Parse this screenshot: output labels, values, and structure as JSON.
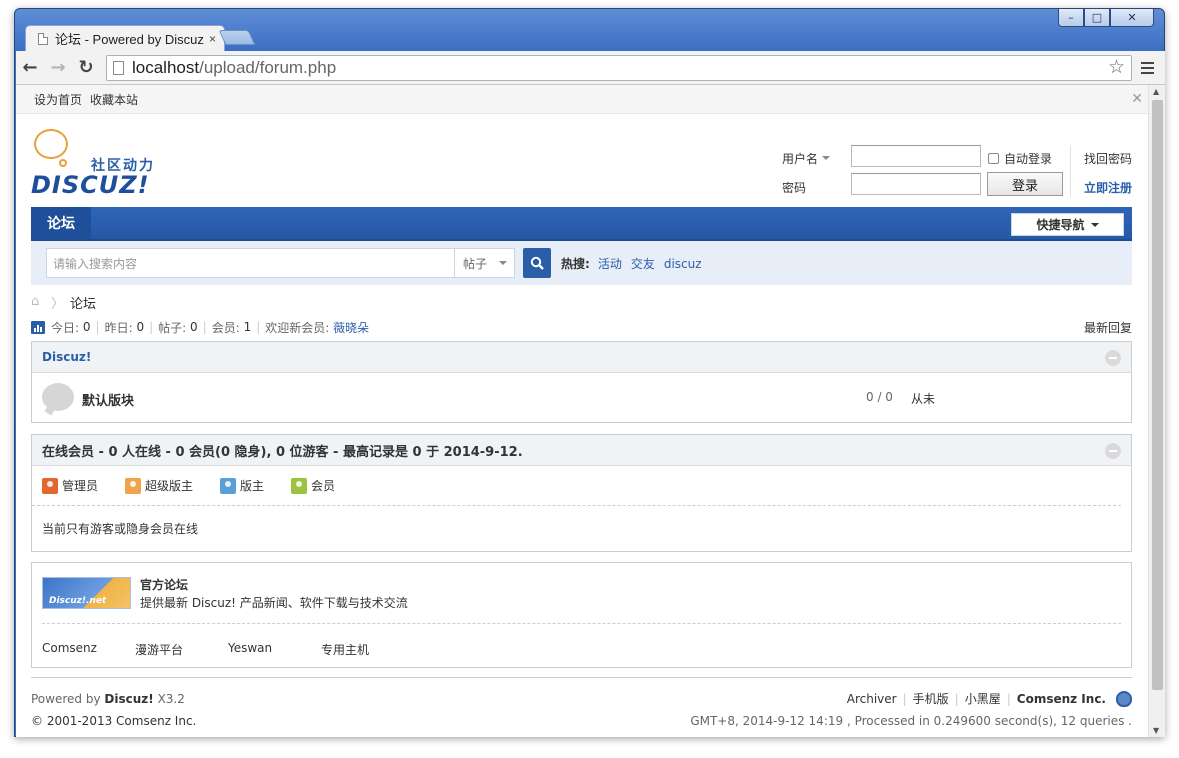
{
  "browser": {
    "tab_title": "论坛 - Powered by Discuz!",
    "tab_close": "×",
    "url_host": "localhost",
    "url_path": "/upload/forum.php",
    "window_buttons": {
      "minimize": "–",
      "maximize": "□",
      "close": "✕"
    },
    "back": "←",
    "forward": "→",
    "reload": "↻",
    "star": "☆"
  },
  "topbar": {
    "set_home": "设为首页",
    "bookmark": "收藏本站",
    "shrink": "✕"
  },
  "logo": {
    "slogan": "社区动力",
    "brand": "DISCUZ!"
  },
  "login": {
    "username_label": "用户名",
    "password_label": "密码",
    "auto_login": "自动登录",
    "login_button": "登录",
    "forgot": "找回密码",
    "register": "立即注册"
  },
  "nav": {
    "current": "论坛",
    "quick_nav": "快捷导航"
  },
  "search": {
    "placeholder": "请输入搜索内容",
    "type": "帖子",
    "hot_label": "热搜:",
    "hot": [
      "活动",
      "交友",
      "discuz"
    ]
  },
  "breadcrumb": {
    "home": "⌂",
    "sep": "〉",
    "current": "论坛"
  },
  "stats": {
    "today_label": "今日:",
    "today": "0",
    "yesterday_label": "昨日:",
    "yesterday": "0",
    "posts_label": "帖子:",
    "posts": "0",
    "members_label": "会员:",
    "members": "1",
    "welcome_label": "欢迎新会员:",
    "newest": "薇晓朵",
    "latest_reply": "最新回复"
  },
  "forum_group": {
    "title": "Discuz!",
    "forums": [
      {
        "name": "默认版块",
        "count": "0 / 0",
        "last_post": "从未"
      }
    ]
  },
  "online": {
    "title": "在线会员 - 0 人在线 - 0 会员(0 隐身), 0 位游客 - 最高记录是 0 于 2014-9-12.",
    "legend": [
      {
        "label": "管理员",
        "color": "#e2662f"
      },
      {
        "label": "超级版主",
        "color": "#eea44a"
      },
      {
        "label": "版主",
        "color": "#5aa0d8"
      },
      {
        "label": "会员",
        "color": "#9cc33b"
      }
    ],
    "note": "当前只有游客或隐身会员在线"
  },
  "links": {
    "banner_text": "Discuz!.net",
    "title": "官方论坛",
    "desc": "提供最新 Discuz! 产品新闻、软件下载与技术交流",
    "friends": [
      "Comsenz",
      "漫游平台",
      "Yeswan",
      "专用主机"
    ]
  },
  "footer": {
    "powered_prefix": "Powered by",
    "powered_brand": "Discuz!",
    "version": "X3.2",
    "copyright": "© 2001-2013 Comsenz Inc.",
    "links": [
      "Archiver",
      "手机版",
      "小黑屋"
    ],
    "company": "Comsenz Inc.",
    "debug": "GMT+8, 2014-9-12 14:19 , Processed in 0.249600 second(s), 12 queries ."
  }
}
